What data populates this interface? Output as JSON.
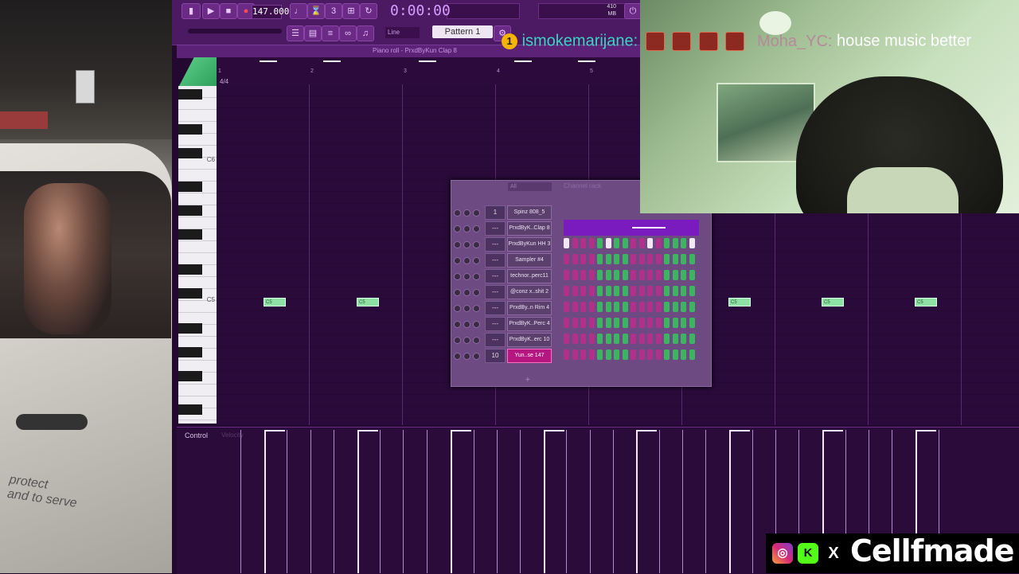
{
  "toolbar": {
    "tempo": "147.000",
    "time": "0:00:00",
    "pattern": "Pattern 1",
    "snap": "Line",
    "memory": "410 MB"
  },
  "piano_roll": {
    "title": "Piano roll - PrxdByKun Clap 8",
    "time_signature": "4/4",
    "bars": [
      "1",
      "2",
      "3",
      "4",
      "5"
    ],
    "octave_labels": [
      "C6",
      "C5"
    ],
    "note_label": "C5",
    "control_label": "Control",
    "control_target": "Velocity"
  },
  "channel_rack": {
    "title": "Channel rack",
    "filter": "All",
    "add": "+",
    "channels": [
      {
        "num": "1",
        "name": "Spinz 808_5"
      },
      {
        "num": "---",
        "name": "PrxdByK..Clap 8"
      },
      {
        "num": "---",
        "name": "PrxdByKun HH 3"
      },
      {
        "num": "---",
        "name": "Sampler #4"
      },
      {
        "num": "---",
        "name": "technor..perc11"
      },
      {
        "num": "---",
        "name": "@conz x..shit 2"
      },
      {
        "num": "---",
        "name": "PrxdBy..n Rim 4"
      },
      {
        "num": "---",
        "name": "PrxdByK..Perc 4"
      },
      {
        "num": "---",
        "name": "PrxdByK..erc 10"
      },
      {
        "num": "10",
        "name": "Yun..se 147"
      }
    ]
  },
  "chat": {
    "badge": "1",
    "user1": "ismokemarijane:",
    "user2": "Moha_YC:",
    "message": " house music better"
  },
  "brand": {
    "name": "Cellfmade",
    "icons": [
      "instagram-icon",
      "kick-icon",
      "x-icon"
    ]
  },
  "left_cam": {
    "decal": "protect\nand to serve"
  }
}
